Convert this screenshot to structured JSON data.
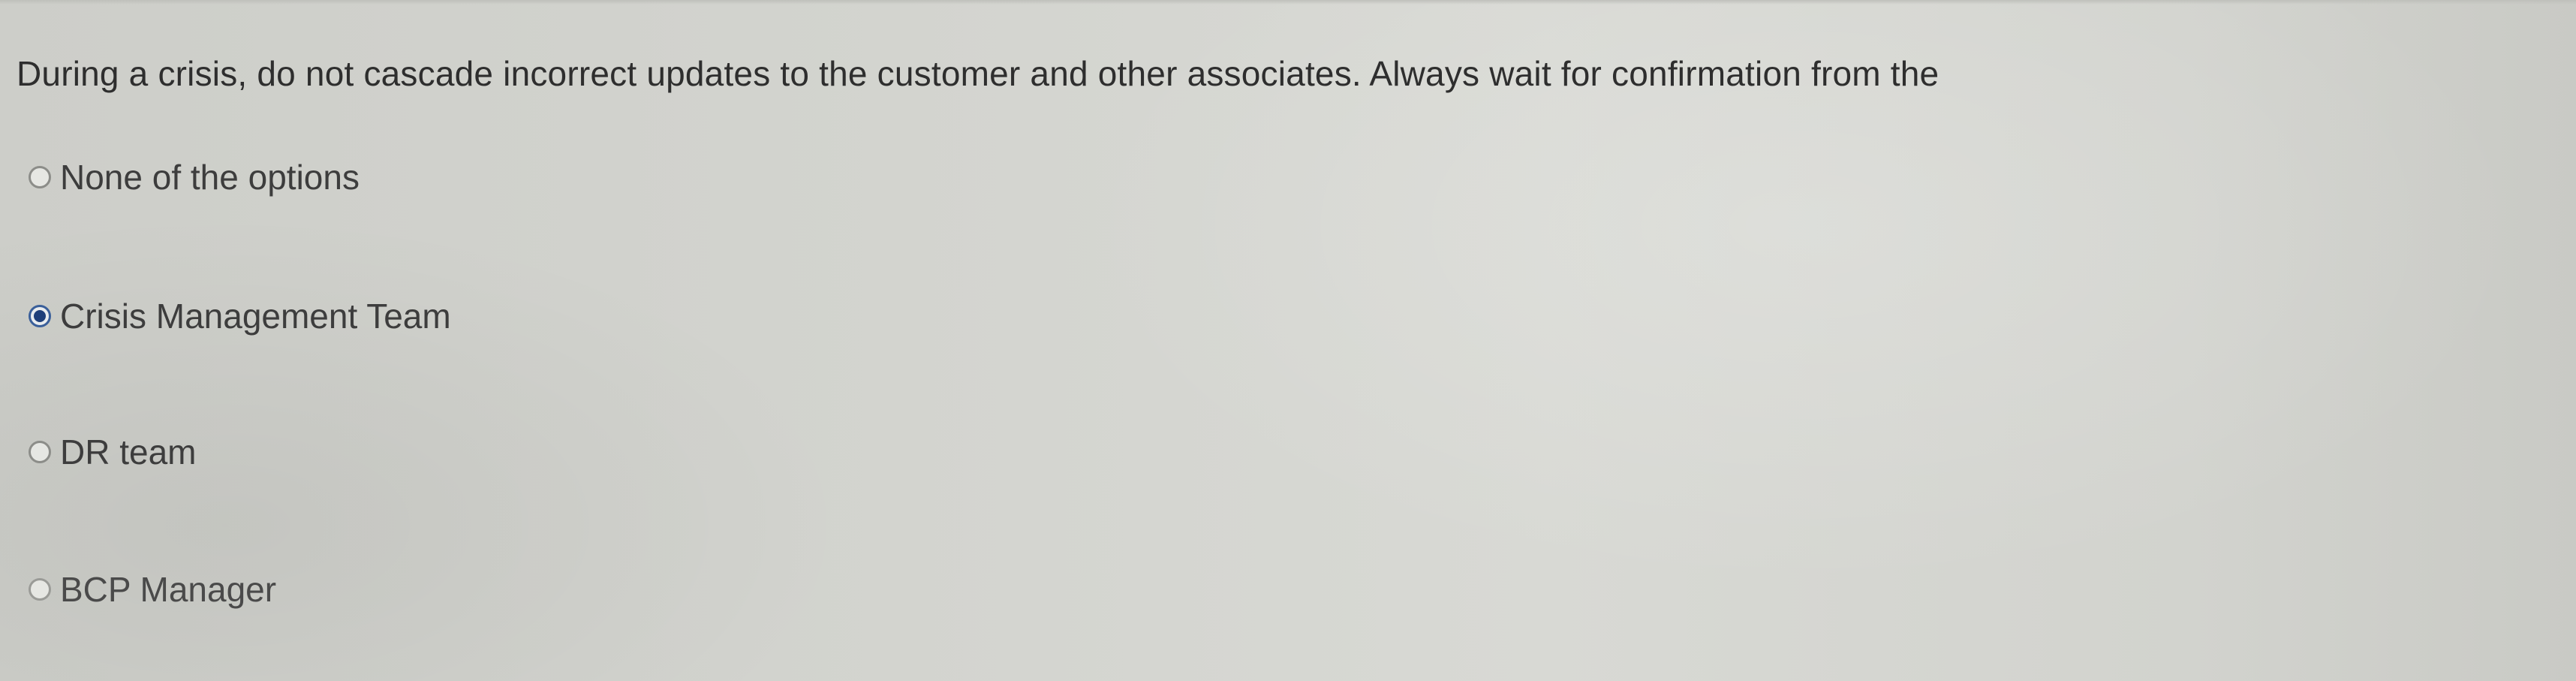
{
  "quiz": {
    "question": "During a crisis, do not cascade incorrect updates to the customer and other associates. Always wait for confirmation from the",
    "options": [
      {
        "label": "None of the options",
        "selected": false
      },
      {
        "label": "Crisis Management Team",
        "selected": true
      },
      {
        "label": "DR team",
        "selected": false
      },
      {
        "label": "BCP Manager",
        "selected": false
      }
    ]
  },
  "colors": {
    "background": "#d3d4cf",
    "text": "#2e2e2e",
    "radio_selected": "#1f3f7a"
  }
}
